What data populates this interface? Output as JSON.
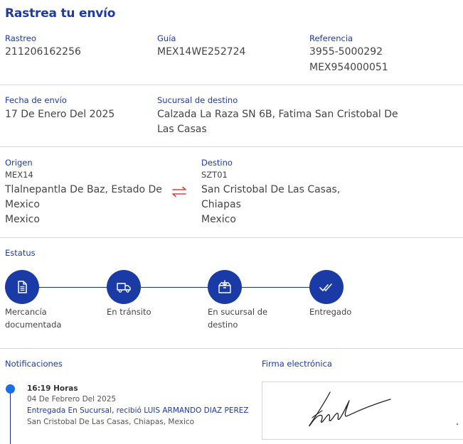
{
  "title": "Rastrea tu envío",
  "shipment": {
    "rastreo_label": "Rastreo",
    "rastreo_value": "211206162256",
    "guia_label": "Guía",
    "guia_value": "MEX14WE252724",
    "referencia_label": "Referencia",
    "referencia_value_1": "3955-5000292",
    "referencia_value_2": "MEX954000051",
    "fecha_label": "Fecha de envío",
    "fecha_value": "17 De Enero Del 2025",
    "sucursal_label": "Sucursal de destino",
    "sucursal_value_1": "Calzada La Raza SN 6B, Fatima San Cristobal De",
    "sucursal_value_2": "Las Casas"
  },
  "origin": {
    "label": "Origen",
    "code": "MEX14",
    "line1": "Tlalnepantla De Baz, Estado De",
    "line2": "Mexico",
    "line3": "Mexico"
  },
  "destination": {
    "label": "Destino",
    "code": "SZT01",
    "line1": "San Cristobal De Las Casas,",
    "line2": "Chiapas",
    "line3": "Mexico"
  },
  "status": {
    "label": "Estatus",
    "steps": [
      {
        "line1": "Mercancía",
        "line2": "documentada",
        "icon": "document-icon"
      },
      {
        "line1": "En tránsito",
        "line2": "",
        "icon": "truck-icon"
      },
      {
        "line1": "En sucursal de",
        "line2": "destino",
        "icon": "package-icon"
      },
      {
        "line1": "Entregado",
        "line2": "",
        "icon": "double-check-icon"
      }
    ]
  },
  "notifications": {
    "label": "Notificaciones",
    "items": [
      {
        "time": "16:19 Horas",
        "date": "04 De Febrero Del 2025",
        "message": "Entregada En Sucursal, recibió LUIS ARMANDO DIAZ PEREZ",
        "location": "San Cristobal De Las Casas, Chiapas, Mexico"
      }
    ]
  },
  "signature": {
    "label": "Firma electrónica"
  },
  "colors": {
    "accent": "#1d3aa8",
    "step_circle": "#1a3ba6",
    "swap_icon": "#e53935",
    "timeline_dot": "#1a6fe6"
  }
}
